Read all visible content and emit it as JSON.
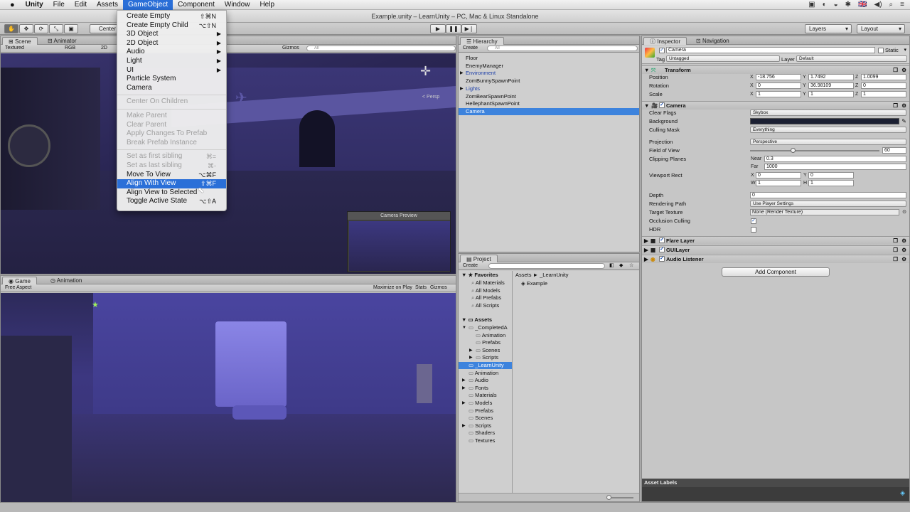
{
  "menubar": {
    "apple": "",
    "app": "Unity",
    "items": [
      "File",
      "Edit",
      "Assets",
      "GameObject",
      "Component",
      "Window",
      "Help"
    ],
    "active_index": 3,
    "status_icons": [
      "▣",
      "◐",
      "◒",
      "✱",
      "🇬🇧",
      "◀)",
      "⌕",
      "≡"
    ]
  },
  "window_title": "Example.unity – LearnUnity – PC, Mac & Linux Standalone",
  "toolbar": {
    "pivot": "Center",
    "play": "▶",
    "pause": "❚❚",
    "step": "▶❘",
    "layers": "Layers",
    "layout": "Layout"
  },
  "scene": {
    "tab_scene": "Scene",
    "tab_animator": "Animator",
    "shading": "Textured",
    "render": "RGB",
    "mode2d": "2D",
    "gizmos": "Gizmos",
    "search": "All",
    "persp": "< Persp",
    "camera_preview": "Camera Preview"
  },
  "game": {
    "tab_game": "Game",
    "tab_animation": "Animation",
    "aspect": "Free Aspect",
    "maximize": "Maximize on Play",
    "stats": "Stats",
    "gizmos": "Gizmos"
  },
  "gameobject_menu": {
    "items": [
      {
        "label": "Create Empty",
        "shortcut": "⇧⌘N",
        "state": "normal"
      },
      {
        "label": "Create Empty Child",
        "shortcut": "⌥⇧N",
        "state": "normal"
      },
      {
        "label": "3D Object",
        "submenu": true,
        "state": "normal"
      },
      {
        "label": "2D Object",
        "submenu": true,
        "state": "normal"
      },
      {
        "label": "Audio",
        "submenu": true,
        "state": "normal"
      },
      {
        "label": "Light",
        "submenu": true,
        "state": "normal"
      },
      {
        "label": "UI",
        "submenu": true,
        "state": "normal"
      },
      {
        "label": "Particle System",
        "state": "normal"
      },
      {
        "label": "Camera",
        "state": "normal"
      },
      {
        "separator": true
      },
      {
        "label": "Center On Children",
        "state": "disabled"
      },
      {
        "separator": true
      },
      {
        "label": "Make Parent",
        "state": "disabled"
      },
      {
        "label": "Clear Parent",
        "state": "disabled"
      },
      {
        "label": "Apply Changes To Prefab",
        "state": "disabled"
      },
      {
        "label": "Break Prefab Instance",
        "state": "disabled"
      },
      {
        "separator": true
      },
      {
        "label": "Set as first sibling",
        "shortcut": "⌘=",
        "state": "disabled"
      },
      {
        "label": "Set as last sibling",
        "shortcut": "⌘-",
        "state": "disabled"
      },
      {
        "label": "Move To View",
        "shortcut": "⌥⌘F",
        "state": "normal"
      },
      {
        "label": "Align With View",
        "shortcut": "⇧⌘F",
        "state": "highlighted"
      },
      {
        "label": "Align View to Selected",
        "state": "normal"
      },
      {
        "label": "Toggle Active State",
        "shortcut": "⌥⇧A",
        "state": "normal"
      }
    ]
  },
  "hierarchy": {
    "tab": "Hierarchy",
    "create": "Create",
    "search": "All",
    "items": [
      {
        "label": "Floor",
        "foldout": false,
        "blue": false,
        "selected": false
      },
      {
        "label": "EnemyManager",
        "foldout": false,
        "blue": false,
        "selected": false
      },
      {
        "label": "Environment",
        "foldout": true,
        "blue": true,
        "selected": false
      },
      {
        "label": "ZomBunnySpawnPoint",
        "foldout": false,
        "blue": false,
        "selected": false
      },
      {
        "label": "Lights",
        "foldout": true,
        "blue": true,
        "selected": false
      },
      {
        "label": "ZomBearSpawnPoint",
        "foldout": false,
        "blue": false,
        "selected": false
      },
      {
        "label": "HellephantSpawnPoint",
        "foldout": false,
        "blue": false,
        "selected": false
      },
      {
        "label": "Camera",
        "foldout": false,
        "blue": false,
        "selected": true
      }
    ]
  },
  "project": {
    "tab": "Project",
    "create": "Create",
    "breadcrumb": "Assets ► _LearnUnity",
    "right_items": [
      "Example"
    ],
    "favorites_label": "Favorites",
    "favorites": [
      "All Materials",
      "All Models",
      "All Prefabs",
      "All Scripts"
    ],
    "assets_label": "Assets",
    "tree": [
      {
        "label": "_CompletedA",
        "indent": 1,
        "fold": "▼"
      },
      {
        "label": "Animation",
        "indent": 2,
        "fold": ""
      },
      {
        "label": "Prefabs",
        "indent": 2,
        "fold": ""
      },
      {
        "label": "Scenes",
        "indent": 2,
        "fold": "▶"
      },
      {
        "label": "Scripts",
        "indent": 2,
        "fold": "▶"
      },
      {
        "label": "_LearnUnity",
        "indent": 1,
        "fold": "",
        "selected": true
      },
      {
        "label": "Animation",
        "indent": 1,
        "fold": ""
      },
      {
        "label": "Audio",
        "indent": 1,
        "fold": "▶"
      },
      {
        "label": "Fonts",
        "indent": 1,
        "fold": "▶"
      },
      {
        "label": "Materials",
        "indent": 1,
        "fold": ""
      },
      {
        "label": "Models",
        "indent": 1,
        "fold": "▶"
      },
      {
        "label": "Prefabs",
        "indent": 1,
        "fold": ""
      },
      {
        "label": "Scenes",
        "indent": 1,
        "fold": ""
      },
      {
        "label": "Scripts",
        "indent": 1,
        "fold": "▶"
      },
      {
        "label": "Shaders",
        "indent": 1,
        "fold": ""
      },
      {
        "label": "Textures",
        "indent": 1,
        "fold": ""
      }
    ]
  },
  "inspector": {
    "tab": "Inspector",
    "tab_nav": "Navigation",
    "name": "Camera",
    "static": "Static",
    "tag_label": "Tag",
    "tag": "Untagged",
    "layer_label": "Layer",
    "layer": "Default",
    "transform": {
      "title": "Transform",
      "rows": [
        {
          "label": "Position",
          "x": "-18.756",
          "y": "1.7492",
          "z": "1.0099"
        },
        {
          "label": "Rotation",
          "x": "0",
          "y": "36.98109",
          "z": "0"
        },
        {
          "label": "Scale",
          "x": "1",
          "y": "1",
          "z": "1"
        }
      ]
    },
    "camera": {
      "title": "Camera",
      "clear_flags_label": "Clear Flags",
      "clear_flags": "Skybox",
      "background_label": "Background",
      "background_color": "#1c2033",
      "culling_label": "Culling Mask",
      "culling": "Everything",
      "projection_label": "Projection",
      "projection": "Perspective",
      "fov_label": "Field of View",
      "fov": "60",
      "fov_fraction": 0.33,
      "clipping_label": "Clipping Planes",
      "near_label": "Near",
      "near": "0.3",
      "far_label": "Far",
      "far": "1000",
      "viewport_label": "Viewport Rect",
      "vx": "0",
      "vy": "0",
      "vw": "1",
      "vh": "1",
      "depth_label": "Depth",
      "depth": "0",
      "rendering_label": "Rendering Path",
      "rendering": "Use Player Settings",
      "target_label": "Target Texture",
      "target": "None (Render Texture)",
      "occlusion_label": "Occlusion Culling",
      "hdr_label": "HDR"
    },
    "components": [
      "Flare Layer",
      "GUILayer",
      "Audio Listener"
    ],
    "add_component": "Add Component",
    "asset_labels": "Asset Labels"
  }
}
